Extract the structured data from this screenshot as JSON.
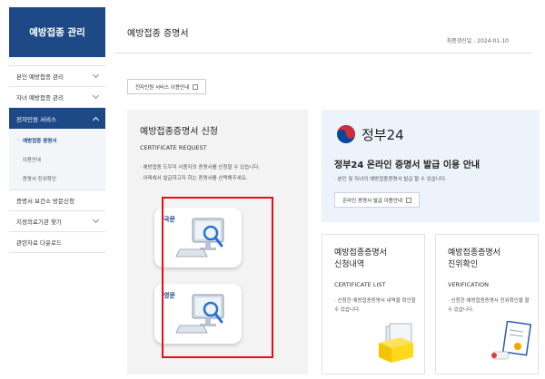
{
  "sidebar": {
    "title": "예방접종 관리",
    "items": [
      {
        "label": "본인 예방접종 관리"
      },
      {
        "label": "자녀 예방접종 관리"
      },
      {
        "label": "전자민원 서비스"
      },
      {
        "label": "증명서 보건소 방문신청"
      },
      {
        "label": "지정의료기관 찾기"
      },
      {
        "label": "관련자료 다운로드"
      }
    ],
    "subitems": [
      {
        "label": "예방접종 증명서"
      },
      {
        "label": "이용안내"
      },
      {
        "label": "증명서 진위확인"
      }
    ]
  },
  "page": {
    "title": "예방접종 증명서",
    "last_update": "최종갱신일 : 2024-01-10"
  },
  "guide_button": {
    "label": "전자민원 서비스 이용안내"
  },
  "cert_request": {
    "title": "예방접종증명서 신청",
    "subtitle": "CERTIFICATE REQUEST",
    "bullets": [
      "예방접종 도우미 사용자의 증명서를 신청할 수 있습니다.",
      "아래에서 발급하고자 하는 증명서를 선택해주세요."
    ],
    "korean_label": "국문",
    "english_label": "영문"
  },
  "gov24": {
    "logo_text": "정부24",
    "title": "정부24 온라인 증명서 발급 이용 안내",
    "desc": "본인 및 자녀의 예방접종증명서 발급 할 수 있습니다.",
    "button_label": "온라인 증명서 발급 이용안내"
  },
  "certificate_list": {
    "title_line1": "예방접종증명서",
    "title_line2": "신청내역",
    "subtitle": "CERTIFICATE LIST",
    "desc": "신청한 예방접종증명서 내역을 확인할 수 있습니다."
  },
  "verification": {
    "title_line1": "예방접종증명서",
    "title_line2": "진위확인",
    "subtitle": "VERIFICATION",
    "desc": "신청한 예방접종증명서 진위확인을 할 수 있습니다."
  },
  "colors": {
    "brand_blue": "#1d4a86",
    "highlight_red": "#e30e1b",
    "gov_red": "#cd2e3a",
    "gov_blue": "#0047a0"
  }
}
